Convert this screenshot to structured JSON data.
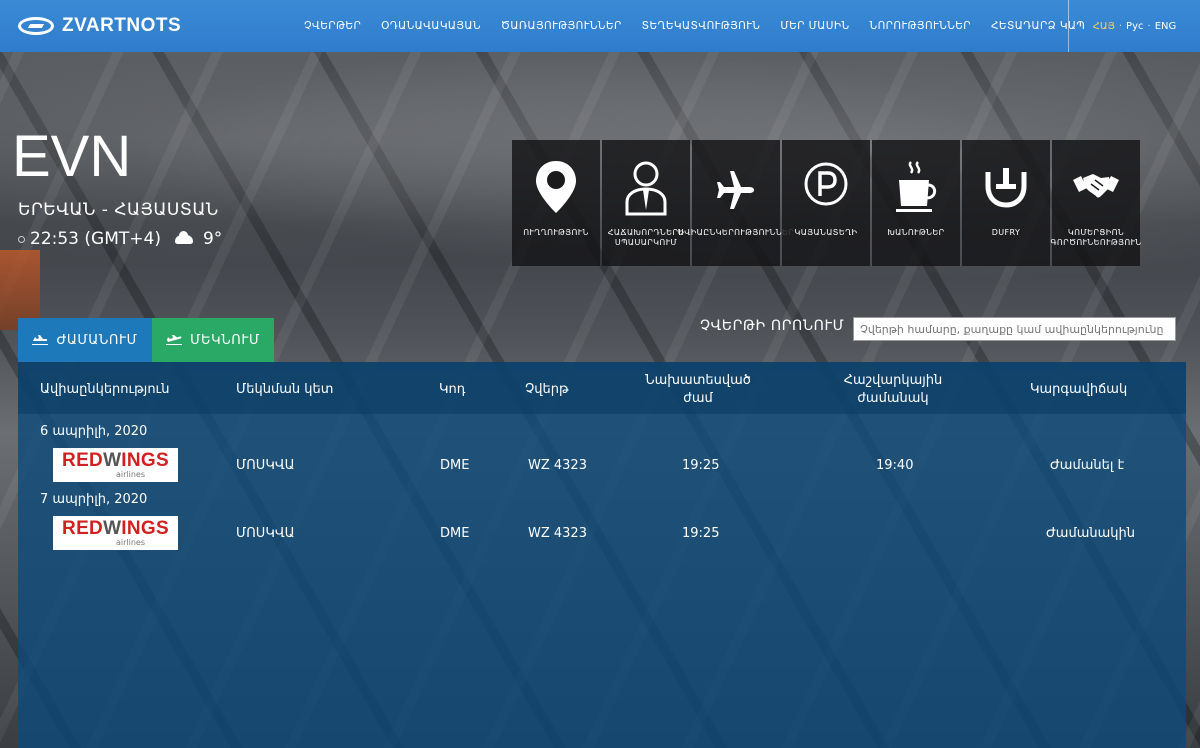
{
  "header": {
    "logo_text": "ZVARTNOTS",
    "nav": [
      "ՉՎԵՐԹԵՐ",
      "ՕԴԱՆԱՎԱԿԱՅԱՆ",
      "ԾԱՌԱՅՈՒԹՅՈՒՆՆԵՐ",
      "ՏԵՂԵԿԱՏՎՈՒԹՅՈՒՆ",
      "ՄԵՐ ՄԱՍԻՆ",
      "ՆՈՐՈՒԹՅՈՒՆՆԵՐ",
      "ՀԵՏԱԴԱՐՁ ԿԱՊ"
    ],
    "langs": {
      "hy": "ՀԱՅ",
      "ru": "Рус",
      "en": "ENG",
      "sep": "·"
    }
  },
  "location": {
    "code": "EVN",
    "city": "ԵՐԵՎԱՆ - ՀԱՅԱՍՏԱՆ",
    "time": "22:53 (GMT+4)",
    "temp": "9°"
  },
  "services": [
    {
      "icon": "map-pin-icon",
      "label": "ՈՒՂՂՈՒԹՅՈՒՆ"
    },
    {
      "icon": "passenger-icon",
      "label": "ՀԱՃԱԽՈՐԴՆԵՐԻ ՍՊԱՍԱՐԿՈՒՄ"
    },
    {
      "icon": "airplane-icon",
      "label": "ԱՎԻԱԸՆԿԵՐՈՒԹՅՈՒՆՆԵՐ"
    },
    {
      "icon": "parking-icon",
      "label": "ԿԱՅԱՆԱՏԵՂԻ"
    },
    {
      "icon": "coffee-icon",
      "label": "ԽԱՆՈՒԹՆԵՐ"
    },
    {
      "icon": "dufry-icon",
      "label": "DUFRY"
    },
    {
      "icon": "handshake-icon",
      "label": "ԿՈՄԵՐՑԻՈՆ ԳՈՐԾՈՒՆԵՈՒԹՅՈՒՆ"
    }
  ],
  "tabs": {
    "arrivals": "ԺԱՄԱՆՈՒՄ",
    "departures": "ՄԵԿՆՈՒՄ"
  },
  "search": {
    "label": "ՉՎԵՐԹԻ ՈՐՈՆՈՒՄ",
    "placeholder": "Չվերթի համարը, քաղաքը կամ ավիաընկերությունը"
  },
  "table": {
    "headers": {
      "airline": "Ավիաընկերություն",
      "origin": "Մեկնման կետ",
      "code": "Կոդ",
      "flight": "Չվերթ",
      "scheduled_1": "Նախատեսված",
      "scheduled_2": "ժամ",
      "estimated_1": "Հաշվարկային",
      "estimated_2": "ժամանակ",
      "status": "Կարգավիճակ"
    },
    "groups": [
      {
        "date": "6 ապրիլի, 2020",
        "flight": {
          "airline_logo_main": "RED",
          "airline_logo_w": "W",
          "airline_logo_rest": "INGS",
          "airline_logo_sub": "airlines",
          "origin": "ՄՈՍԿՎԱ",
          "code": "DME",
          "flight": "WZ 4323",
          "scheduled": "19:25",
          "estimated": "19:40",
          "status": "Ժամանել է"
        }
      },
      {
        "date": "7 ապրիլի, 2020",
        "flight": {
          "airline_logo_main": "RED",
          "airline_logo_w": "W",
          "airline_logo_rest": "INGS",
          "airline_logo_sub": "airlines",
          "origin": "ՄՈՍԿՎԱ",
          "code": "DME",
          "flight": "WZ 4323",
          "scheduled": "19:25",
          "estimated": "",
          "status": "Ժամանակին"
        }
      }
    ]
  },
  "colors": {
    "header_blue": "#3a8bd6",
    "arrivals_tab": "#1d79b9",
    "departures_tab": "#2aa866",
    "lang_active": "#f7d35b",
    "board_bg": "#0c4a7a",
    "airline_red": "#d1201f"
  }
}
